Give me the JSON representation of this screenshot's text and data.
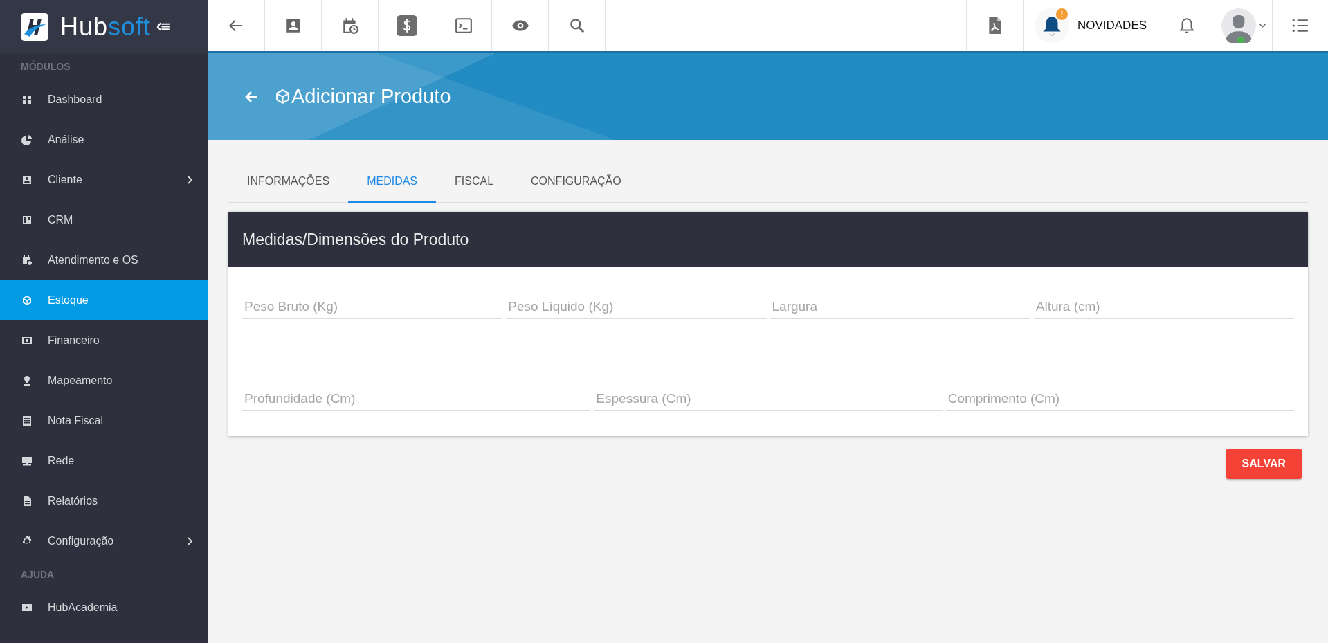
{
  "brand": {
    "name_part_1": "Hub",
    "name_part_2": "soft"
  },
  "sidebar": {
    "sections": [
      {
        "title": "MÓDULOS",
        "items": [
          {
            "label": "Dashboard",
            "selected": false,
            "has_submenu": false
          },
          {
            "label": "Análise",
            "selected": false,
            "has_submenu": false
          },
          {
            "label": "Cliente",
            "selected": false,
            "has_submenu": true
          },
          {
            "label": "CRM",
            "selected": false,
            "has_submenu": false
          },
          {
            "label": "Atendimento e OS",
            "selected": false,
            "has_submenu": false
          },
          {
            "label": "Estoque",
            "selected": true,
            "has_submenu": false
          },
          {
            "label": "Financeiro",
            "selected": false,
            "has_submenu": false
          },
          {
            "label": "Mapeamento",
            "selected": false,
            "has_submenu": false
          },
          {
            "label": "Nota Fiscal",
            "selected": false,
            "has_submenu": false
          },
          {
            "label": "Rede",
            "selected": false,
            "has_submenu": false
          },
          {
            "label": "Relatórios",
            "selected": false,
            "has_submenu": false
          },
          {
            "label": "Configuração",
            "selected": false,
            "has_submenu": true
          }
        ]
      },
      {
        "title": "AJUDA",
        "items": [
          {
            "label": "HubAcademia",
            "selected": false,
            "has_submenu": false
          }
        ]
      }
    ]
  },
  "topbar": {
    "news_label": "NOVIDADES",
    "news_badge": "!"
  },
  "page_header": {
    "title": "Adicionar Produto"
  },
  "tabs": [
    {
      "label": "INFORMAÇÕES",
      "selected": false
    },
    {
      "label": "MEDIDAS",
      "selected": true
    },
    {
      "label": "FISCAL",
      "selected": false
    },
    {
      "label": "CONFIGURAÇÃO",
      "selected": false
    }
  ],
  "card": {
    "title": "Medidas/Dimensões do Produto",
    "field_rows": [
      [
        {
          "placeholder": "Peso Bruto (Kg)"
        },
        {
          "placeholder": "Peso Líquido (Kg)"
        },
        {
          "placeholder": "Largura"
        },
        {
          "placeholder": "Altura (cm)"
        }
      ],
      [
        {
          "placeholder": "Profundidade (Cm)"
        },
        {
          "placeholder": "Espessura (Cm)"
        },
        {
          "placeholder": "Comprimento (Cm)"
        }
      ]
    ]
  },
  "save_button": "SALVAR"
}
